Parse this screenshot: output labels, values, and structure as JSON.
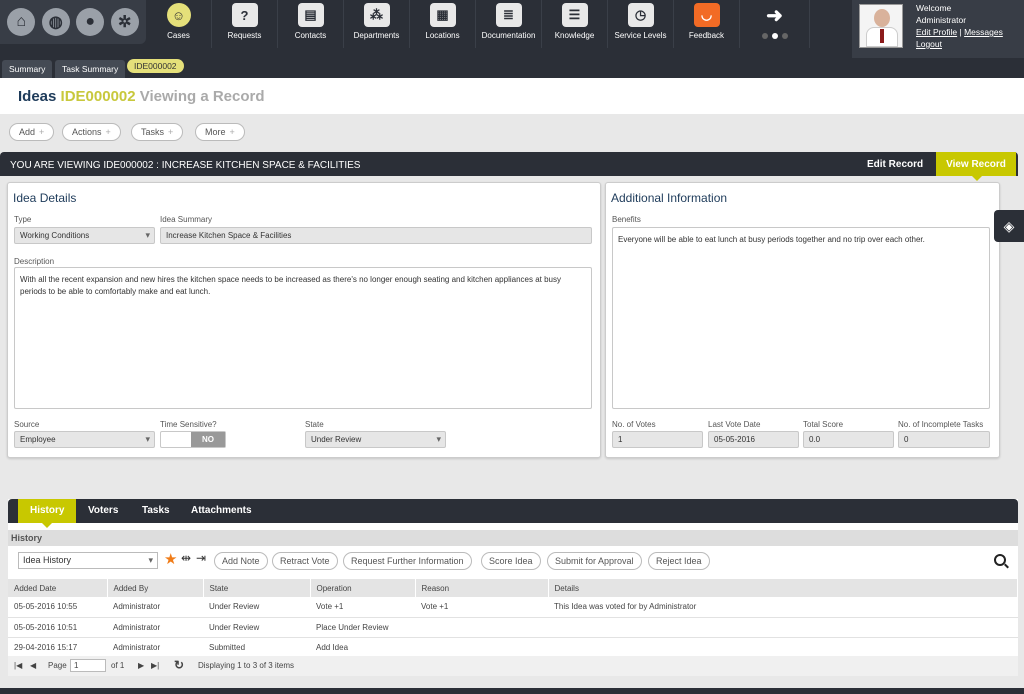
{
  "nav": {
    "home_icons": [
      "home-icon",
      "globe-icon",
      "user-icon",
      "gears-icon"
    ],
    "items": [
      {
        "label": "Cases",
        "icon": "cases-icon"
      },
      {
        "label": "Requests",
        "icon": "requests-icon"
      },
      {
        "label": "Contacts",
        "icon": "contacts-icon"
      },
      {
        "label": "Departments",
        "icon": "departments-icon"
      },
      {
        "label": "Locations",
        "icon": "locations-icon"
      },
      {
        "label": "Documentation",
        "icon": "documentation-icon"
      },
      {
        "label": "Knowledge",
        "icon": "knowledge-icon"
      },
      {
        "label": "Service Levels",
        "icon": "service-levels-icon"
      },
      {
        "label": "Feedback",
        "icon": "feedback-icon"
      }
    ]
  },
  "user": {
    "welcome": "Welcome",
    "name": "Administrator",
    "edit_profile": "Edit Profile",
    "separator": "|",
    "messages": "Messages",
    "logout": "Logout"
  },
  "page_tabs": [
    "Summary",
    "Task Summary",
    "IDE000002"
  ],
  "title": {
    "main": "Ideas",
    "id": "IDE000002",
    "sub": "Viewing a Record"
  },
  "actions": [
    "Add",
    "Actions",
    "Tasks",
    "More"
  ],
  "view_header": {
    "text": "YOU ARE VIEWING IDE000002 : INCREASE KITCHEN SPACE & FACILITIES",
    "edit": "Edit Record",
    "view": "View Record"
  },
  "idea_details": {
    "title": "Idea Details",
    "type_label": "Type",
    "type_value": "Working Conditions",
    "summary_label": "Idea Summary",
    "summary_value": "Increase Kitchen Space & Facilities",
    "description_label": "Description",
    "description_value": "With all the recent expansion and new hires the kitchen space needs to be increased as there's no longer enough seating and kitchen appliances at busy periods to be able to comfortably make and eat lunch.",
    "source_label": "Source",
    "source_value": "Employee",
    "time_label": "Time Sensitive?",
    "time_value": "NO",
    "state_label": "State",
    "state_value": "Under Review"
  },
  "additional": {
    "title": "Additional Information",
    "benefits_label": "Benefits",
    "benefits_value": "Everyone will be able to eat lunch at busy periods together and no trip over each other.",
    "votes_label": "No. of Votes",
    "votes_value": "1",
    "lastvote_label": "Last Vote Date",
    "lastvote_value": "05-05-2016",
    "score_label": "Total Score",
    "score_value": "0.0",
    "incomplete_label": "No. of Incomplete Tasks",
    "incomplete_value": "0"
  },
  "lower_tabs": [
    "History",
    "Voters",
    "Tasks",
    "Attachments"
  ],
  "history": {
    "strip": "History",
    "select": "Idea History",
    "buttons": [
      "Add Note",
      "Retract Vote",
      "Request Further Information",
      "Score Idea",
      "Submit for Approval",
      "Reject Idea"
    ],
    "columns": [
      "Added Date",
      "Added By",
      "State",
      "Operation",
      "Reason",
      "Details"
    ],
    "rows": [
      [
        "05-05-2016 10:55",
        "Administrator",
        "Under Review",
        "Vote +1",
        "Vote +1",
        "This Idea was voted for by Administrator"
      ],
      [
        "05-05-2016 10:51",
        "Administrator",
        "Under Review",
        "Place Under Review",
        "",
        ""
      ],
      [
        "29-04-2016 15:17",
        "Administrator",
        "Submitted",
        "Add Idea",
        "",
        ""
      ]
    ],
    "pager": {
      "page_label": "Page",
      "page_value": "1",
      "of_label": "of 1",
      "display": "Displaying 1 to 3 of 3 items"
    }
  }
}
